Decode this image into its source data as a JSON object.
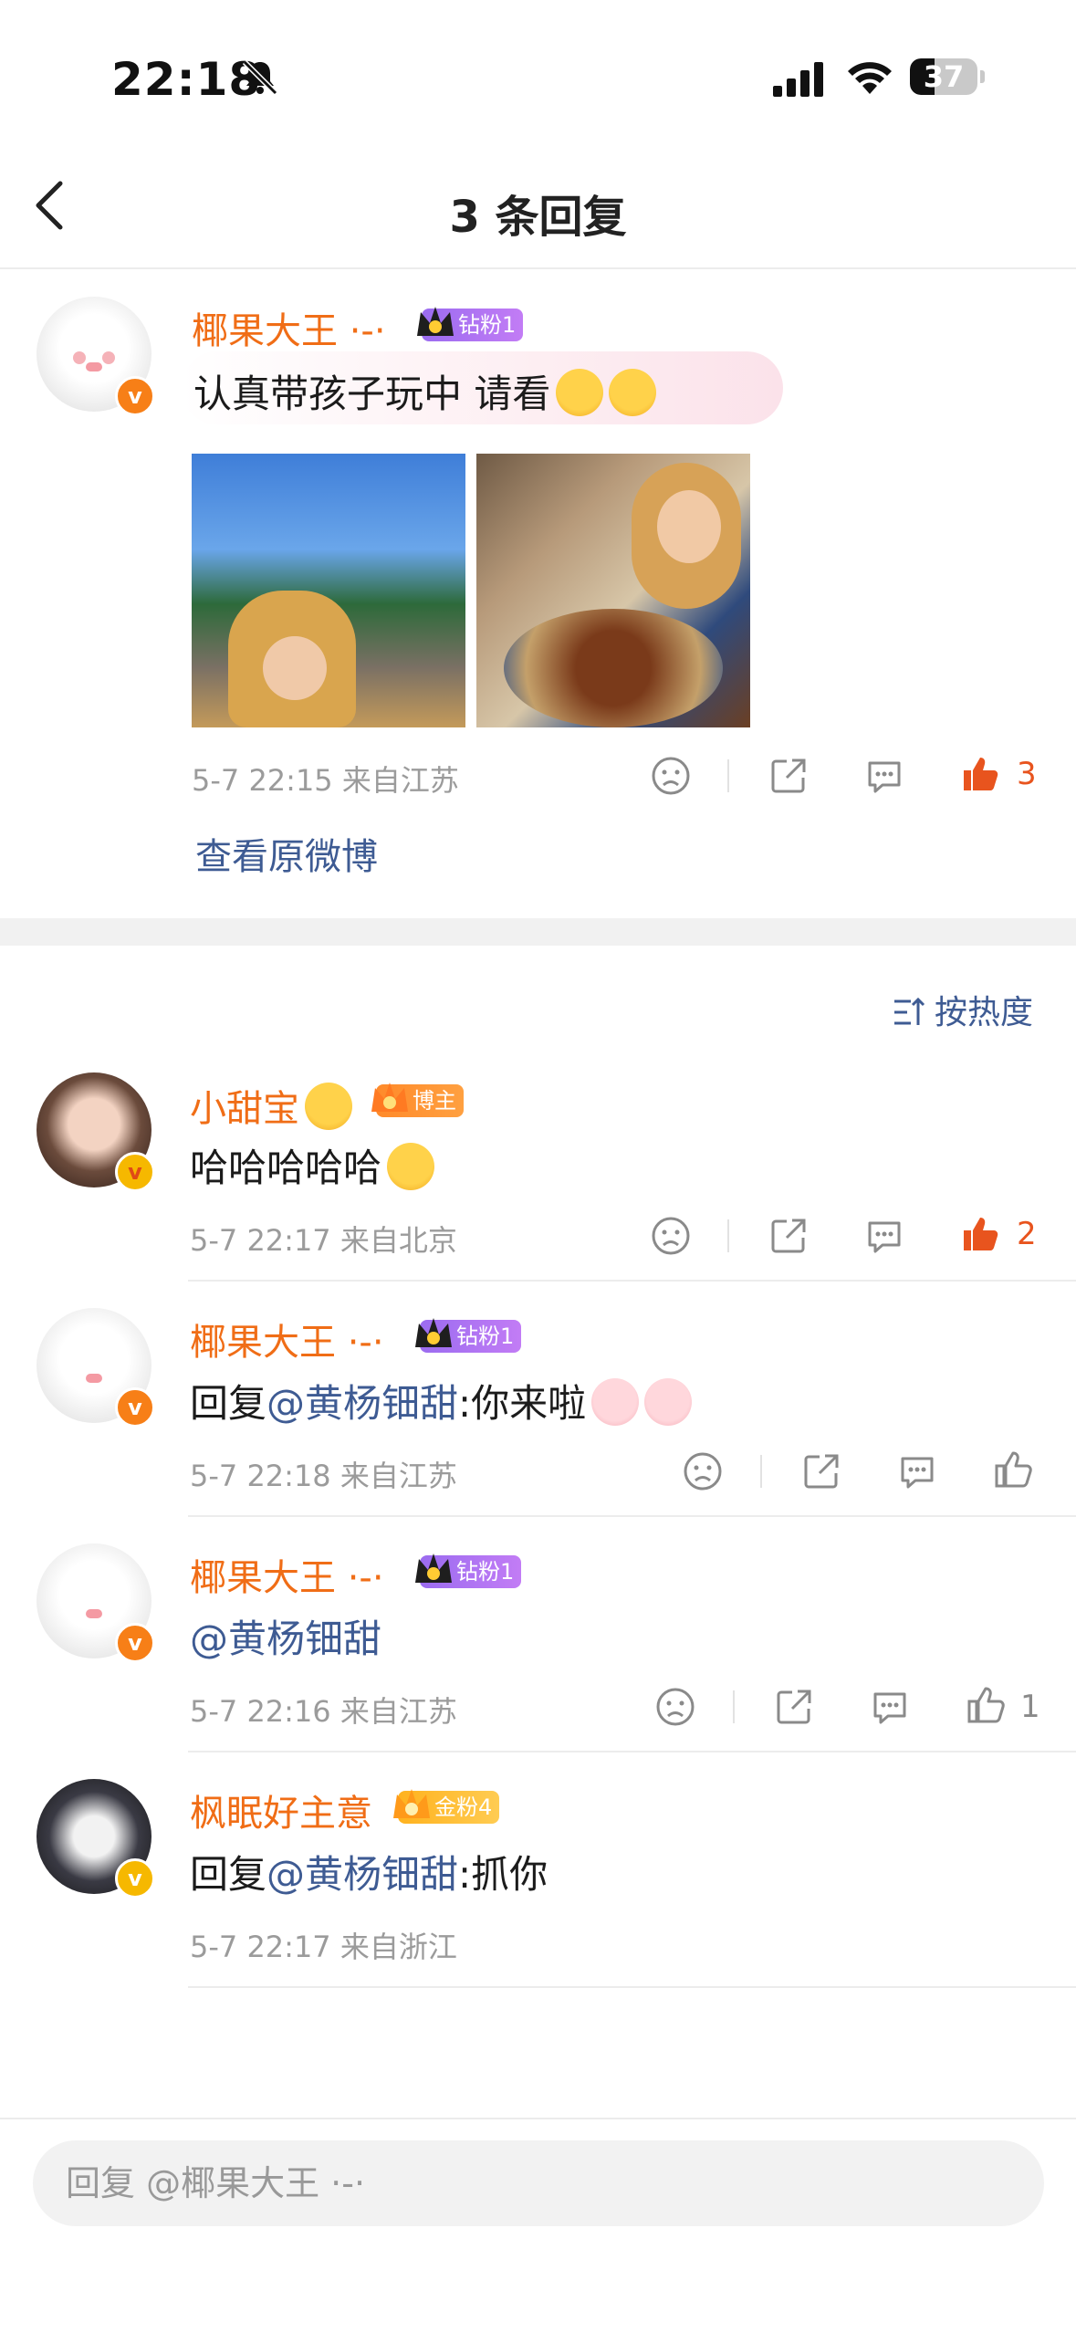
{
  "status": {
    "time": "22:18",
    "battery": "37",
    "battery_level": 0.37
  },
  "nav": {
    "title": "3 条回复"
  },
  "main_comment": {
    "user": "椰果大王 ·-·",
    "tag": "钻粉1",
    "text": "认真带孩子玩中 请看",
    "meta": "5-7 22:15  来自江苏",
    "likes": "3",
    "view_original": "查看原微博"
  },
  "sort_label": "按热度",
  "replies": [
    {
      "user": "小甜宝",
      "tag": "博主",
      "text": "哈哈哈哈哈",
      "meta": "5-7 22:17  来自北京",
      "likes": "2"
    },
    {
      "user": "椰果大王 ·-·",
      "tag": "钻粉1",
      "prefix": "回复",
      "mention": "@黄杨钿甜",
      "text": ":你来啦",
      "meta": "5-7 22:18  来自江苏",
      "likes": ""
    },
    {
      "user": "椰果大王 ·-·",
      "tag": "钻粉1",
      "mention": "@黄杨钿甜",
      "meta": "5-7 22:16  来自江苏",
      "likes": "1"
    },
    {
      "user": "枫眠好主意",
      "tag": "金粉4",
      "prefix": "回复",
      "mention": "@黄杨钿甜",
      "text": ":抓你",
      "meta": "5-7 22:17  来自浙江"
    }
  ],
  "input": {
    "placeholder": "回复 @椰果大王 ·-·"
  },
  "colors": {
    "accent_orange": "#f06d16",
    "link_blue": "#3e5b93",
    "like_red": "#e8541e"
  }
}
